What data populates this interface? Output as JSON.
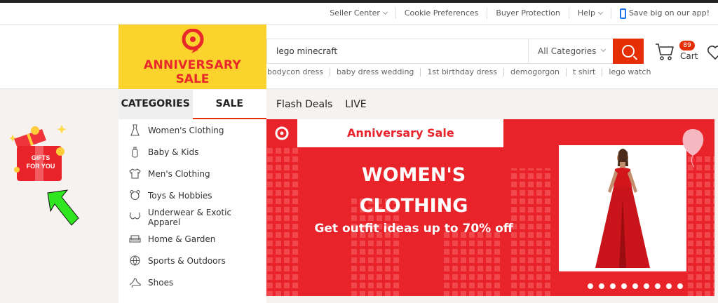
{
  "topbar": {
    "seller_center": "Seller Center",
    "cookie_preferences": "Cookie Preferences",
    "buyer_protection": "Buyer Protection",
    "help": "Help",
    "app_promo": "Save big on our app!"
  },
  "logo": {
    "line1": "ANNIVERSARY",
    "line2": "SALE"
  },
  "search": {
    "query": "lego minecraft",
    "category": "All Categories",
    "suggestions": [
      "bodycon dress",
      "baby dress wedding",
      "1st birthday dress",
      "demogorgon",
      "t shirt",
      "lego watch"
    ]
  },
  "cart": {
    "count": "89",
    "label": "Cart"
  },
  "tabs": {
    "categories": "CATEGORIES",
    "sale": "SALE"
  },
  "nav": {
    "flash_deals": "Flash Deals",
    "live": "LIVE"
  },
  "categories": [
    {
      "label": "Women's Clothing",
      "icon": "dress-icon"
    },
    {
      "label": "Baby & Kids",
      "icon": "baby-bottle-icon"
    },
    {
      "label": "Men's Clothing",
      "icon": "shirt-icon"
    },
    {
      "label": "Toys & Hobbies",
      "icon": "toy-bear-icon"
    },
    {
      "label": "Underwear & Exotic Apparel",
      "icon": "bra-icon"
    },
    {
      "label": "Home & Garden",
      "icon": "sofa-icon"
    },
    {
      "label": "Sports & Outdoors",
      "icon": "ball-icon"
    },
    {
      "label": "Shoes",
      "icon": "heel-icon"
    }
  ],
  "banner": {
    "tag": "Anniversary Sale",
    "headline_1": "WOMEN'S",
    "headline_2": "CLOTHING",
    "subline": "Get outfit ideas up to 70% off",
    "slide_count": 9
  },
  "gift": {
    "label_1": "GIFTS",
    "label_2": "FOR YOU"
  },
  "colors": {
    "brand_red": "#e62e04",
    "banner_red": "#e8232a",
    "logo_yellow": "#fbd32d",
    "arrow_green": "#2ee51f"
  }
}
